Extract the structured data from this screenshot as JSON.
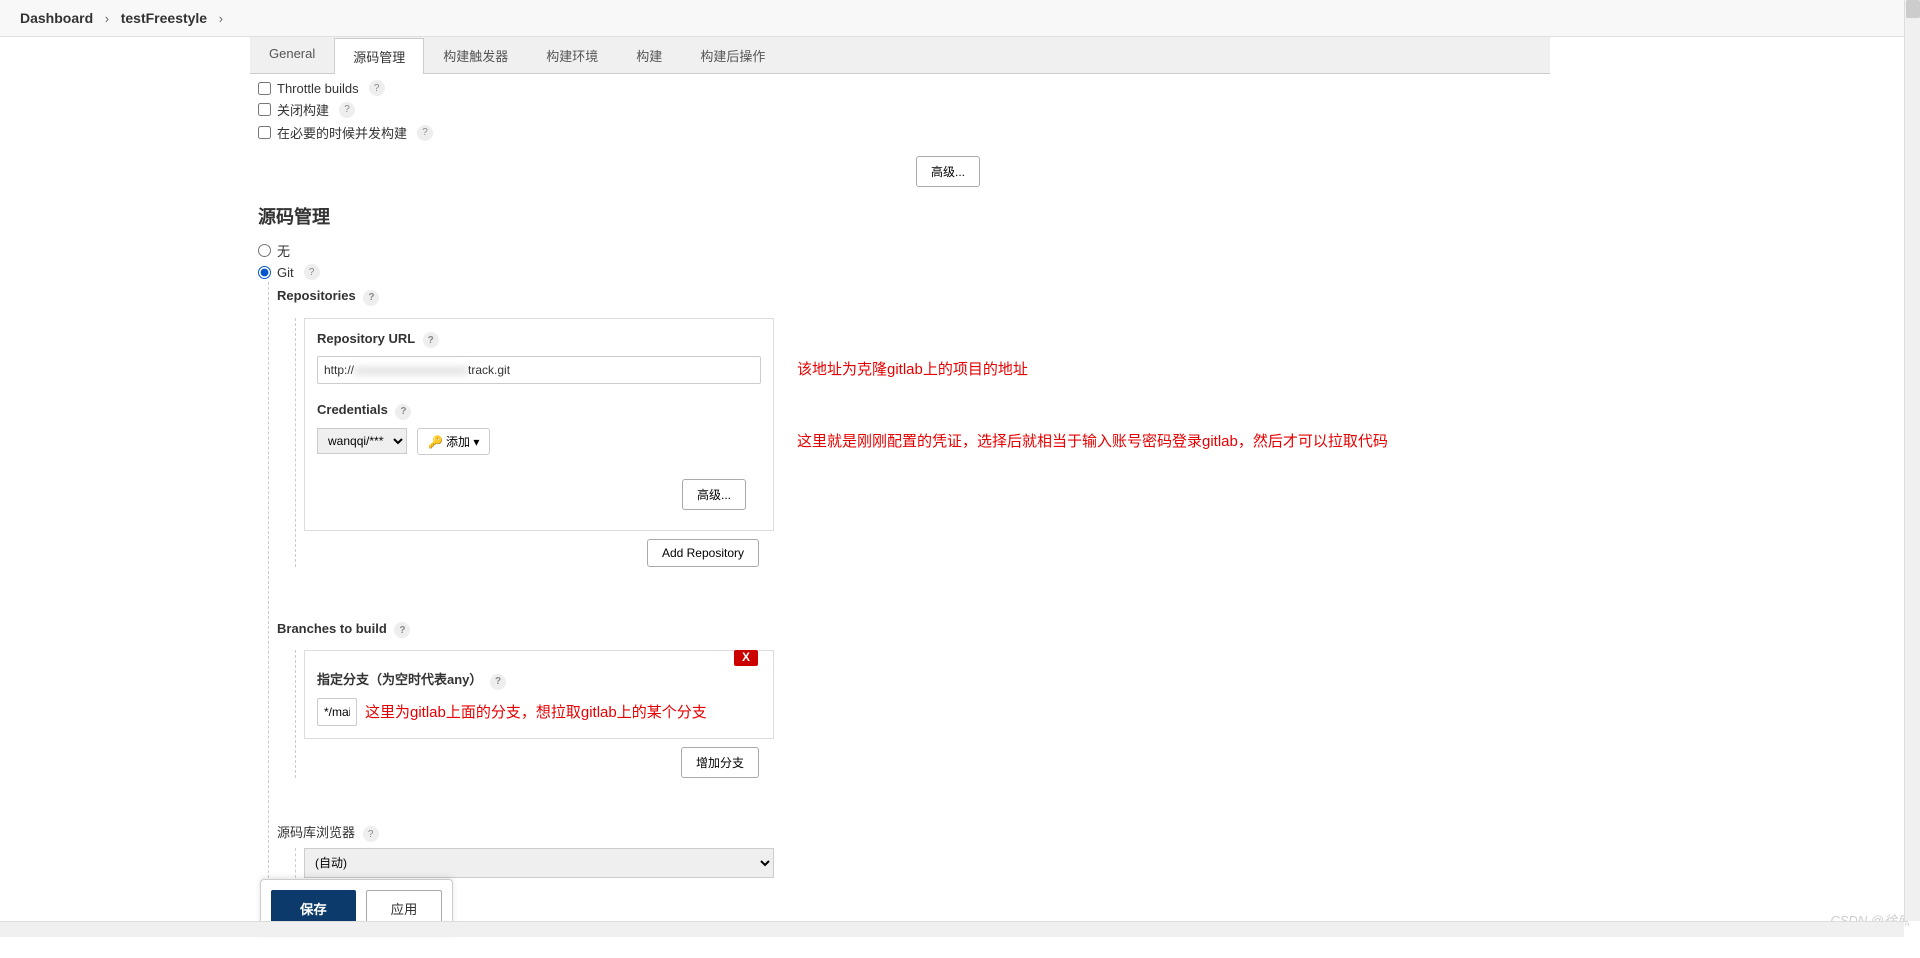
{
  "breadcrumb": {
    "dashboard": "Dashboard",
    "project": "testFreestyle"
  },
  "tabs": {
    "general": "General",
    "scm": "源码管理",
    "triggers": "构建触发器",
    "env": "构建环境",
    "build": "构建",
    "post": "构建后操作"
  },
  "options": {
    "throttle": "Throttle builds",
    "close": "关闭构建",
    "concurrent": "在必要的时候并发构建"
  },
  "buttons": {
    "advanced": "高级...",
    "add_repo": "Add Repository",
    "add_branch": "增加分支",
    "save": "保存",
    "apply": "应用",
    "add_cred": "添加"
  },
  "scm": {
    "heading": "源码管理",
    "none": "无",
    "git": "Git",
    "repositories": "Repositories",
    "repo_url_label": "Repository URL",
    "repo_url_prefix": "http://",
    "repo_url_suffix": "track.git",
    "credentials_label": "Credentials",
    "credentials_value": "wanqqi/******",
    "branches_label": "Branches to build",
    "branch_spec_label": "指定分支（为空时代表any）",
    "branch_value": "*/main",
    "browser_label": "源码库浏览器",
    "browser_value": "(自动)"
  },
  "annotations": {
    "url": "该地址为克隆gitlab上的项目的地址",
    "cred": "这里就是刚刚配置的凭证，选择后就相当于输入账号密码登录gitlab，然后才可以拉取代码",
    "branch": "这里为gitlab上面的分支，想拉取gitlab上的某个分支"
  },
  "watermark": "CSDN @徐庶",
  "misc": {
    "delete_x": "X",
    "dropdown_caret": "▾"
  }
}
